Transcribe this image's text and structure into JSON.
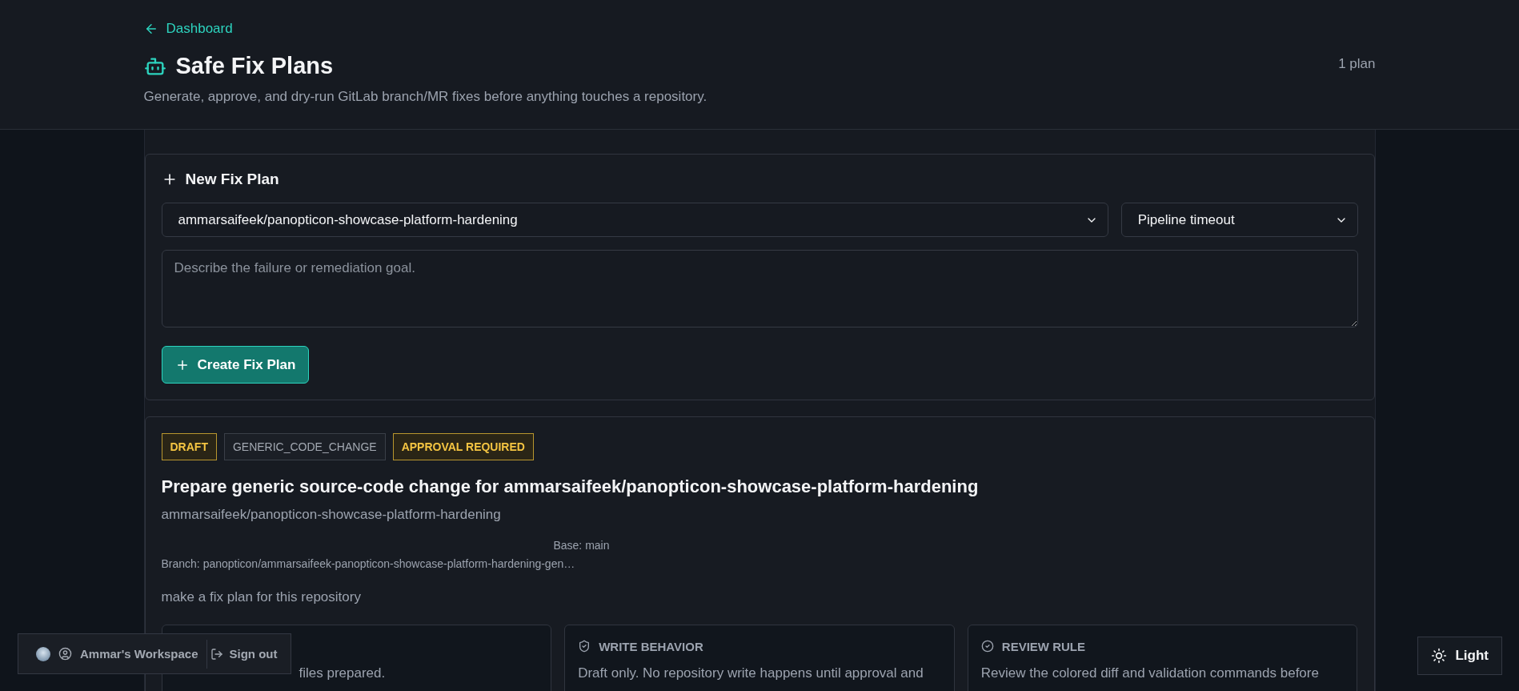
{
  "nav": {
    "back_link": "Dashboard"
  },
  "header": {
    "title": "Safe Fix Plans",
    "subtitle": "Generate, approve, and dry-run GitLab branch/MR fixes before anything touches a repository.",
    "count": "1 plan"
  },
  "new_plan": {
    "title": "New Fix Plan",
    "repository_select": {
      "value": "ammarsaifeek/panopticon-showcase-platform-hardening"
    },
    "category_select": {
      "value": "Pipeline timeout"
    },
    "goal": {
      "placeholder": "Describe the failure or remediation goal."
    },
    "create_button": "Create Fix Plan"
  },
  "plans": [
    {
      "badges": [
        {
          "label": "DRAFT",
          "kind": "warning"
        },
        {
          "label": "GENERIC_CODE_CHANGE",
          "kind": "neutral"
        },
        {
          "label": "APPROVAL REQUIRED",
          "kind": "warning"
        }
      ],
      "title": "Prepare generic source-code change for ammarsaifeek/panopticon-showcase-platform-hardening",
      "repository": "ammarsaifeek/panopticon-showcase-platform-hardening",
      "base": "Base: main",
      "branch": "Branch: panopticon/ammarsaifeek-panopticon-showcase-platform-hardening-gen…",
      "description": "make a fix plan for this repository",
      "info_cards": [
        {
          "kind": "files",
          "body": "files prepared."
        },
        {
          "kind": "write",
          "heading": "WRITE BEHAVIOR",
          "body": "Draft only. No repository write happens until approval and"
        },
        {
          "kind": "review",
          "heading": "REVIEW RULE",
          "body": "Review the colored diff and validation commands before"
        }
      ]
    }
  ],
  "workspace": {
    "name": "Ammar's Workspace",
    "sign_out": "Sign out"
  },
  "theme_toggle": {
    "label": "Light"
  }
}
